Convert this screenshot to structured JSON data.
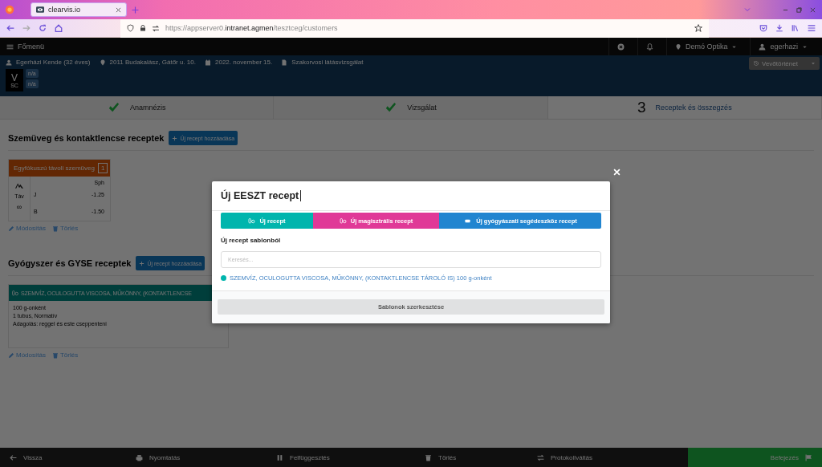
{
  "browser": {
    "tab_title": "clearvis.io",
    "url_prefix": "https://appserver0.",
    "url_host": "intranet.agmen",
    "url_path": "/tesztceg/customers"
  },
  "nav": {
    "menu": "Főmenü",
    "location": "Demó Optika",
    "user": "egerhazi"
  },
  "patient": {
    "name": "Egerházi Kende (32 éves)",
    "address": "2011 Budakalász, Gátőr u. 10.",
    "date": "2022. november 15.",
    "exam_type": "Szakorvosi látásvizsgálat",
    "badge_letter": "V",
    "badge_sub": "SC",
    "badge_values": [
      "n/a",
      "n/a"
    ],
    "history_button": "Vevőtörténet"
  },
  "steps": [
    {
      "label": "Anamnézis",
      "done": true,
      "selected": false
    },
    {
      "label": "Vizsgálat",
      "done": true,
      "selected": false
    },
    {
      "label": "Receptek és összegzés",
      "done": false,
      "number": "3",
      "selected": true
    }
  ],
  "sections": [
    {
      "title": "Szemüveg és kontaktlencse receptek",
      "add_button": "Új recept hozzáadása",
      "card": {
        "kind": "glasses",
        "header": "Egyfókuszú távoli szemüveg",
        "count": "1",
        "column": "Sph",
        "distance_label": "Táv",
        "distance_symbol": "∞",
        "rows": [
          {
            "eye": "J",
            "sph": "-1.25"
          },
          {
            "eye": "B",
            "sph": "-1.50"
          }
        ]
      },
      "actions": [
        "Módosítás",
        "Törlés"
      ]
    },
    {
      "title": "Gyógyszer és GYSE receptek",
      "add_button": "Új recept hozzáadása",
      "card": {
        "kind": "drug",
        "header": "SZEMVÍZ, OCULOGUTTA VISCOSA, MŰKÖNNY, (KONTAKTLENCSE",
        "lines": [
          "100 g-onként",
          "1 tubus, Normatív",
          "Adagolás: reggel és este cseppenteni"
        ]
      },
      "actions": [
        "Módosítás",
        "Törlés"
      ]
    }
  ],
  "footer": {
    "items": [
      {
        "kind": "back",
        "label": "Vissza"
      },
      {
        "kind": "print",
        "label": "Nyomtatás"
      },
      {
        "kind": "pause",
        "label": "Felfüggesztés"
      },
      {
        "kind": "delete",
        "label": "Törlés"
      },
      {
        "kind": "switch",
        "label": "Protokollváltás"
      }
    ],
    "finish": "Befejezés"
  },
  "modal": {
    "title": "Új EESZT recept",
    "buttons": [
      {
        "kind": "pills",
        "label": "Új recept",
        "color": "#00b5ad"
      },
      {
        "kind": "pills",
        "label": "Új magisztrális recept",
        "color": "#e03997"
      },
      {
        "kind": "device",
        "label": "Új gyógyászati segédeszköz recept",
        "color": "#2185d0"
      }
    ],
    "subtitle": "Új recept sablonból",
    "search": {
      "placeholder": "Keresés..."
    },
    "templates": [
      {
        "label": "SZEMVÍZ, OCULOGUTTA VISCOSA, MŰKÖNNY, (KONTAKTLENCSE TÁROLÓ IS) 100 g-onként",
        "color": "#00b5ad"
      }
    ],
    "footer_button": "Sablonok szerkesztése"
  }
}
